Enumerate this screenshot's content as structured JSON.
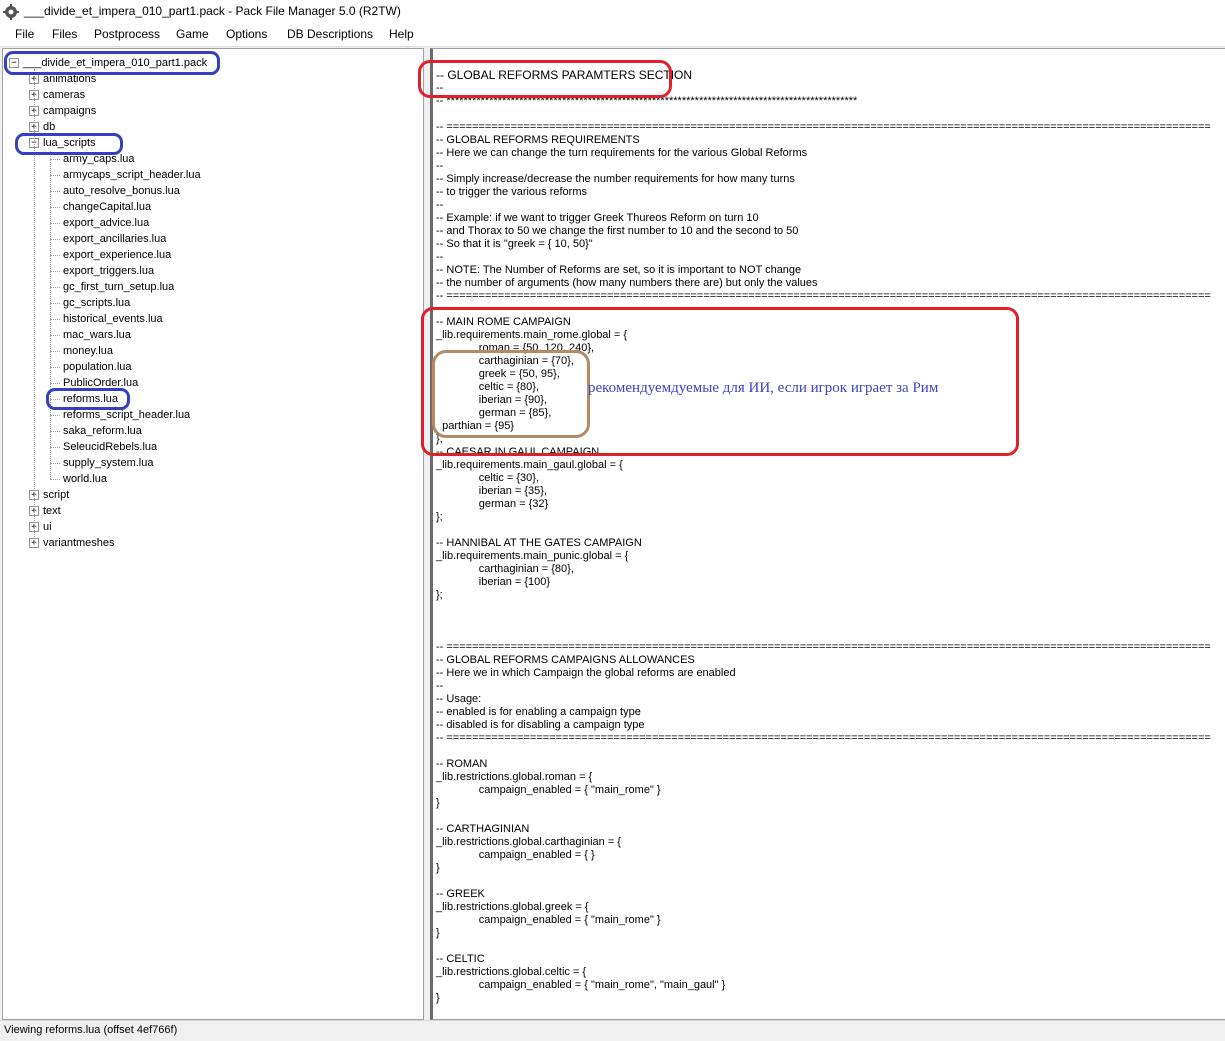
{
  "window": {
    "title": "___divide_et_impera_010_part1.pack - Pack File Manager 5.0 (R2TW)",
    "icon": "gear-icon"
  },
  "menu": [
    "File",
    "Files",
    "Postprocess",
    "Game",
    "Options",
    "DB Descriptions",
    "Help"
  ],
  "tree": {
    "root": "___divide_et_impera_010_part1.pack",
    "folders_top": [
      "animations",
      "cameras",
      "campaigns",
      "db"
    ],
    "open_folder": "lua_scripts",
    "files": [
      "army_caps.lua",
      "armycaps_script_header.lua",
      "auto_resolve_bonus.lua",
      "changeCapital.lua",
      "export_advice.lua",
      "export_ancillaries.lua",
      "export_experience.lua",
      "export_triggers.lua",
      "gc_first_turn_setup.lua",
      "gc_scripts.lua",
      "historical_events.lua",
      "mac_wars.lua",
      "money.lua",
      "population.lua",
      "PublicOrder.lua",
      "reforms.lua",
      "reforms_script_header.lua",
      "saka_reform.lua",
      "SeleucidRebels.lua",
      "supply_system.lua",
      "world.lua"
    ],
    "folders_bottom": [
      "script",
      "text",
      "ui",
      "variantmeshes"
    ],
    "selected_file": "reforms.lua"
  },
  "editor": {
    "lines": [
      "-- GLOBAL REFORMS PARAMTERS SECTION",
      "--",
      "-- ************************************************************************************************",
      "",
      "-- =======================================================================================================================",
      "-- GLOBAL REFORMS REQUIREMENTS",
      "-- Here we can change the turn requirements for the various Global Reforms",
      "--",
      "-- Simply increase/decrease the number requirements for how many turns",
      "-- to trigger the various reforms",
      "--",
      "-- Example: if we want to trigger Greek Thureos Reform on turn 10",
      "-- and Thorax to 50 we change the first number to 10 and the second to 50",
      "-- So that it is \"greek = { 10, 50}\"",
      "--",
      "-- NOTE: The Number of Reforms are set, so it is important to NOT change",
      "-- the number of arguments (how many numbers there are) but only the values",
      "-- =======================================================================================================================",
      "",
      "-- MAIN ROME CAMPAIGN",
      "_lib.requirements.main_rome.global = {",
      "              roman = {50, 120, 240},",
      "              carthaginian = {70},",
      "              greek = {50, 95},",
      "              celtic = {80},",
      "              iberian = {90},",
      "              german = {85},",
      "  parthian = {95}",
      "};",
      "-- CAESAR IN GAUL CAMPAIGN",
      "_lib.requirements.main_gaul.global = {",
      "              celtic = {30},",
      "              iberian = {35},",
      "              german = {32}",
      "};",
      "",
      "-- HANNIBAL AT THE GATES CAMPAIGN",
      "_lib.requirements.main_punic.global = {",
      "              carthaginian = {80},",
      "              iberian = {100}",
      "};",
      "",
      "",
      "",
      "-- =======================================================================================================================",
      "-- GLOBAL REFORMS CAMPAIGNS ALLOWANCES",
      "-- Here we in which Campaign the global reforms are enabled",
      "--",
      "-- Usage:",
      "-- enabled is for enabling a campaign type",
      "-- disabled is for disabling a campaign type",
      "-- =======================================================================================================================",
      "",
      "-- ROMAN",
      "_lib.restrictions.global.roman = {",
      "              campaign_enabled = { \"main_rome\" }",
      "}",
      "",
      "-- CARTHAGINIAN",
      "_lib.restrictions.global.carthaginian = {",
      "              campaign_enabled = { }",
      "}",
      "",
      "-- GREEK",
      "_lib.restrictions.global.greek = {",
      "              campaign_enabled = { \"main_rome\" }",
      "}",
      "",
      "-- CELTIC",
      "_lib.restrictions.global.celtic = {",
      "              campaign_enabled = { \"main_rome\", \"main_gaul\" }",
      "}"
    ]
  },
  "annotation": "рекомендуемдуемые для ИИ, если игрок играет за Рим",
  "status": "Viewing reforms.lua (offset 4ef766f)",
  "colors": {
    "red_mark": "#e0202a",
    "blue_mark": "#3540c0",
    "brown_mark": "#b58a66",
    "annotation": "#3b45c6"
  }
}
